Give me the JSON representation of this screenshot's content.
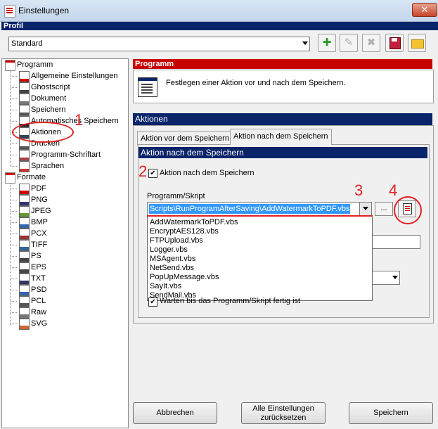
{
  "window": {
    "title": "Einstellungen",
    "close_glyph": "✕"
  },
  "profile": {
    "header": "Profil",
    "selected": "Standard",
    "toolbar": [
      "add-profile-icon",
      "rename-profile-icon",
      "delete-profile-icon",
      "save-profile-icon",
      "open-profile-icon"
    ]
  },
  "tree": {
    "root_programm": "Programm",
    "programm_items": [
      "Allgemeine Einstellungen",
      "Ghostscript",
      "Dokument",
      "Speichern",
      "Automatisches Speichern",
      "Aktionen",
      "Drucken",
      "Programm-Schriftart",
      "Sprachen"
    ],
    "root_formate": "Formate",
    "formate_items": [
      "PDF",
      "PNG",
      "JPEG",
      "BMP",
      "PCX",
      "TIFF",
      "PS",
      "EPS",
      "TXT",
      "PSD",
      "PCL",
      "Raw",
      "SVG"
    ]
  },
  "programm_section": {
    "header": "Programm",
    "description": "Festlegen einer Aktion vor und nach dem Speichern."
  },
  "aktionen_section": {
    "header": "Aktionen",
    "tabs": [
      "Aktion vor dem Speichern",
      "Aktion nach dem Speichern"
    ],
    "active_tab": 1,
    "inner_header": "Aktion nach dem Speichern",
    "enable_checkbox_label": "Aktion nach dem Speichern",
    "enable_checked": true,
    "script_label": "Programm/Skript",
    "script_value": "Scripts\\RunProgramAfterSaving\\AddWatermarkToPDF.vbs",
    "browse_label": "...",
    "dropdown_options": [
      "AddWatermarkToPDF.vbs",
      "EncryptAES128.vbs",
      "FTPUpload.vbs",
      "Logger.vbs",
      "MSAgent.vbs",
      "NetSend.vbs",
      "PopUpMessage.vbs",
      "SayIt.vbs",
      "SendMail.vbs"
    ],
    "wait_checkbox_label": "Warten bis das Programm/Skript fertig ist",
    "wait_checked": true
  },
  "buttons": {
    "cancel": "Abbrechen",
    "reset_line1": "Alle Einstellungen",
    "reset_line2": "zurücksetzen",
    "save": "Speichern"
  },
  "annotations": {
    "n1": "1",
    "n2": "2",
    "n3": "3",
    "n4": "4"
  },
  "colors": {
    "accent_red": "#c80000",
    "section_blue": "#0a246a",
    "annotation_red": "#d22222",
    "selection_blue": "#3399ff"
  }
}
